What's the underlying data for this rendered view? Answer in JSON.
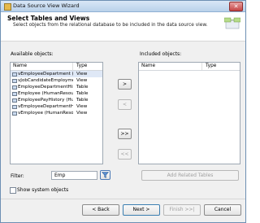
{
  "window": {
    "title": "Data Source View Wizard",
    "close_glyph": "✕"
  },
  "header": {
    "title": "Select Tables and Views",
    "description": "Select objects from the relational database to be included in the data source view."
  },
  "available": {
    "label": "Available objects:",
    "col_name": "Name",
    "col_type": "Type",
    "rows": [
      {
        "name": "vEmployeeDepartment (H...",
        "type": "View"
      },
      {
        "name": "vJobCandidateEmployme...",
        "type": "View"
      },
      {
        "name": "EmployeeDepartmentHist...",
        "type": "Table"
      },
      {
        "name": "Employee (HumanResour...",
        "type": "Table"
      },
      {
        "name": "EmployeePayHistory (Hu...",
        "type": "Table"
      },
      {
        "name": "vEmployeeDepartmentHi...",
        "type": "View"
      },
      {
        "name": "vEmployee (HumanResou...",
        "type": "View"
      }
    ]
  },
  "included": {
    "label": "Included objects:",
    "col_name": "Name",
    "col_type": "Type"
  },
  "move_buttons": {
    "add": ">",
    "remove": "<",
    "add_all": ">>",
    "remove_all": "<<"
  },
  "filter": {
    "label": "Filter:",
    "value": "Emp"
  },
  "add_related_label": "Add Related Tables",
  "show_system_label": "Show system objects",
  "footer": {
    "back": "< Back",
    "next": "Next >",
    "finish": "Finish >>|",
    "cancel": "Cancel"
  }
}
